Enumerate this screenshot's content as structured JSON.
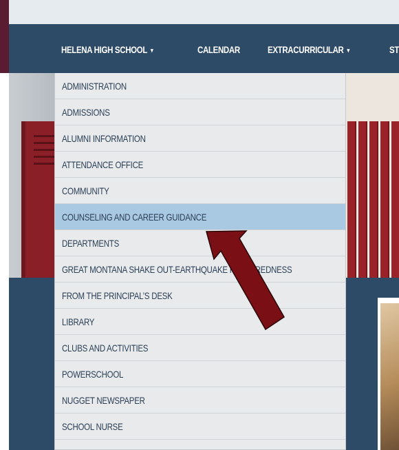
{
  "nav": {
    "items": [
      {
        "label": "HELENA HIGH SCHOOL",
        "has_dropdown": true
      },
      {
        "label": "CALENDAR",
        "has_dropdown": false
      },
      {
        "label": "EXTRACURRICULAR",
        "has_dropdown": true
      },
      {
        "label": "ST",
        "has_dropdown": false
      }
    ]
  },
  "dropdown": {
    "items": [
      {
        "label": "ADMINISTRATION"
      },
      {
        "label": "ADMISSIONS"
      },
      {
        "label": "ALUMNI INFORMATION"
      },
      {
        "label": "ATTENDANCE OFFICE"
      },
      {
        "label": "COMMUNITY"
      },
      {
        "label": "COUNSELING AND CAREER GUIDANCE",
        "highlighted": true
      },
      {
        "label": "DEPARTMENTS"
      },
      {
        "label": "GREAT MONTANA SHAKE OUT-EARTHQUAKE PREPAREDNESS"
      },
      {
        "label": "FROM THE PRINCIPAL’S DESK"
      },
      {
        "label": "LIBRARY"
      },
      {
        "label": "CLUBS AND ACTIVITIES"
      },
      {
        "label": "POWERSCHOOL"
      },
      {
        "label": "NUGGET NEWSPAPER"
      },
      {
        "label": "SCHOOL NURSE"
      }
    ]
  },
  "icons": {
    "caret": "▾",
    "annotation_arrow": "red-arrow-icon"
  },
  "colors": {
    "maroon_frame": "#5a1c30",
    "nav_background": "#2d4a66",
    "dropdown_background": "#e8eaec",
    "highlight": "#a9c8e2",
    "menu_text": "#2b3f55",
    "arrow_fill": "#7a1016"
  }
}
